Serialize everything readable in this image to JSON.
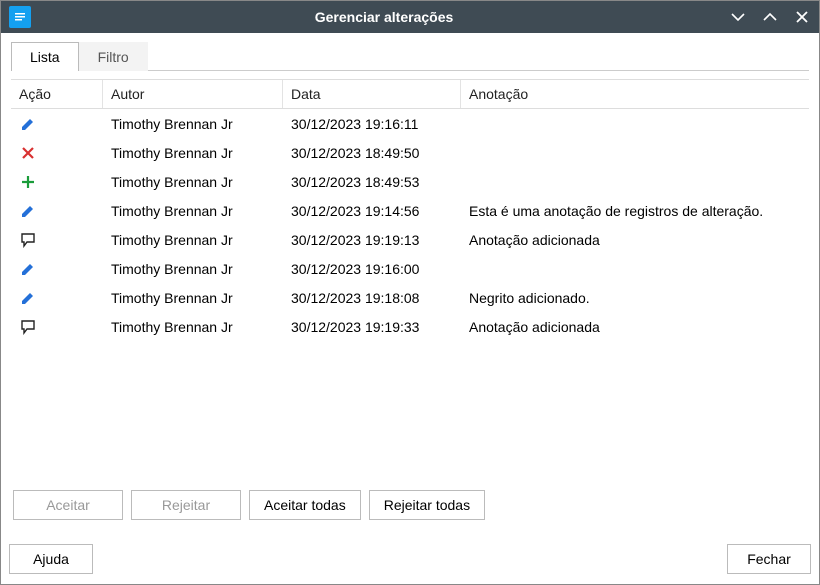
{
  "titlebar": {
    "title": "Gerenciar alterações"
  },
  "tabs": {
    "list": "Lista",
    "filter": "Filtro"
  },
  "columns": {
    "action": "Ação",
    "author": "Autor",
    "date": "Data",
    "comment": "Anotação"
  },
  "rows": [
    {
      "type": "edit",
      "author": "Timothy Brennan Jr",
      "date": "30/12/2023 19:16:11",
      "comment": ""
    },
    {
      "type": "delete",
      "author": "Timothy Brennan Jr",
      "date": "30/12/2023 18:49:50",
      "comment": ""
    },
    {
      "type": "insert",
      "author": "Timothy Brennan Jr",
      "date": "30/12/2023 18:49:53",
      "comment": ""
    },
    {
      "type": "edit",
      "author": "Timothy Brennan Jr",
      "date": "30/12/2023 19:14:56",
      "comment": "Esta é uma anotação de registros de alteração."
    },
    {
      "type": "comment",
      "author": "Timothy Brennan Jr",
      "date": "30/12/2023 19:19:13",
      "comment": "Anotação adicionada"
    },
    {
      "type": "edit",
      "author": "Timothy Brennan Jr",
      "date": "30/12/2023 19:16:00",
      "comment": ""
    },
    {
      "type": "edit",
      "author": "Timothy Brennan Jr",
      "date": "30/12/2023 19:18:08",
      "comment": "Negrito adicionado."
    },
    {
      "type": "comment",
      "author": "Timothy Brennan Jr",
      "date": "30/12/2023 19:19:33",
      "comment": "Anotação adicionada"
    }
  ],
  "buttons": {
    "accept": "Aceitar",
    "reject": "Rejeitar",
    "acceptAll": "Aceitar todas",
    "rejectAll": "Rejeitar todas",
    "help": "Ajuda",
    "close": "Fechar"
  }
}
